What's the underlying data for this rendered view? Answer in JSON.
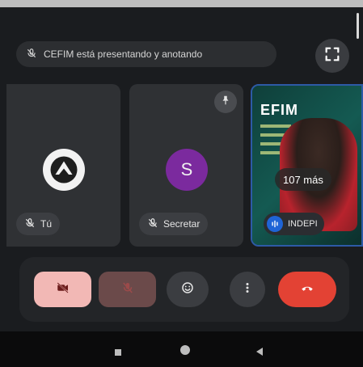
{
  "presenting_banner": {
    "text": "CEFIM está presentando y anotando"
  },
  "participants": {
    "you": {
      "name": "Tú"
    },
    "secretary": {
      "name": "Secretar",
      "avatar_letter": "S"
    },
    "more": {
      "count_label": "107 más",
      "presenter_tag": "INDEPI",
      "shared_title": "EFIM"
    }
  },
  "controls": {
    "camera": "video-off-icon",
    "microphone": "mic-off-icon",
    "reactions": "emoji-icon",
    "more": "more-vertical-icon",
    "hangup": "call-end-icon"
  },
  "colors": {
    "background": "#1a1c1f",
    "hangup": "#e34234",
    "camera_off": "#f2b8b5",
    "secretary_avatar": "#7b2a9e",
    "active_border": "#2d5aa6"
  }
}
